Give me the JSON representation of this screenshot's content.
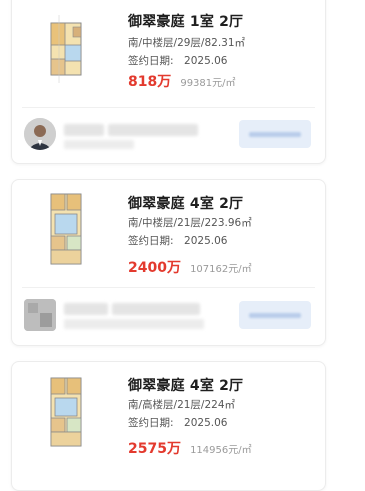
{
  "listings": [
    {
      "title": "御翠豪庭 1室 2厅",
      "details": "南/中楼层/29层/82.31㎡",
      "signed": "签约日期:　2025.06",
      "price": "818万",
      "unit_price": "99381元/㎡"
    },
    {
      "title": "御翠豪庭 4室 2厅",
      "details": "南/中楼层/21层/223.96㎡",
      "signed": "签约日期:　2025.06",
      "price": "2400万",
      "unit_price": "107162元/㎡"
    },
    {
      "title": "御翠豪庭 4室 2厅",
      "details": "南/高楼层/21层/224㎡",
      "signed": "签约日期:　2025.06",
      "price": "2575万",
      "unit_price": "114956元/㎡"
    }
  ],
  "colors": {
    "price": "#e33a2e",
    "contact_button": "#e6eef9",
    "divider": "#f0f0f0"
  }
}
